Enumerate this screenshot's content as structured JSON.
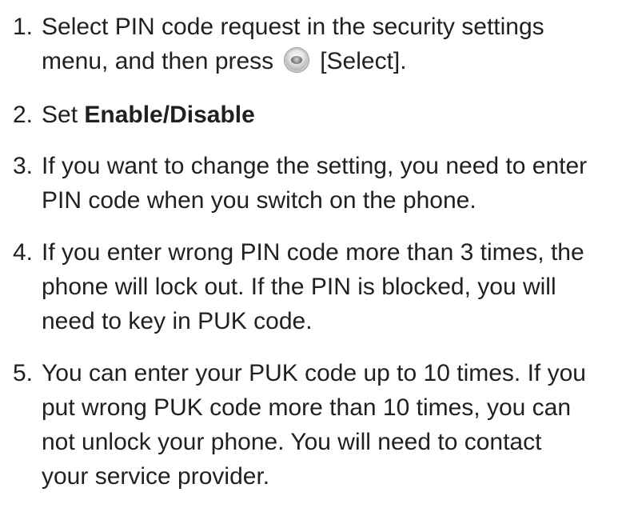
{
  "steps": [
    {
      "number": "1.",
      "line1": "Select PIN code request in the security settings",
      "line2_before": "menu, and then press",
      "icon": "select-key-icon",
      "line2_after": "[Select]."
    },
    {
      "number": "2.",
      "text_before": "Set ",
      "bold": "Enable/Disable"
    },
    {
      "number": "3.",
      "lines": [
        "If you want to change the setting, you need to enter",
        "PIN code when you switch on the phone."
      ]
    },
    {
      "number": "4.",
      "lines": [
        "If you enter wrong PIN code more than 3 times, the",
        "phone will lock out. If the PIN is blocked, you will",
        "need to key in PUK code."
      ]
    },
    {
      "number": "5.",
      "lines": [
        "You can enter your PUK code up to 10 times. If you",
        "put wrong PUK code more than 10 times, you can",
        "not unlock your phone. You will need to contact",
        "your service provider."
      ]
    }
  ]
}
